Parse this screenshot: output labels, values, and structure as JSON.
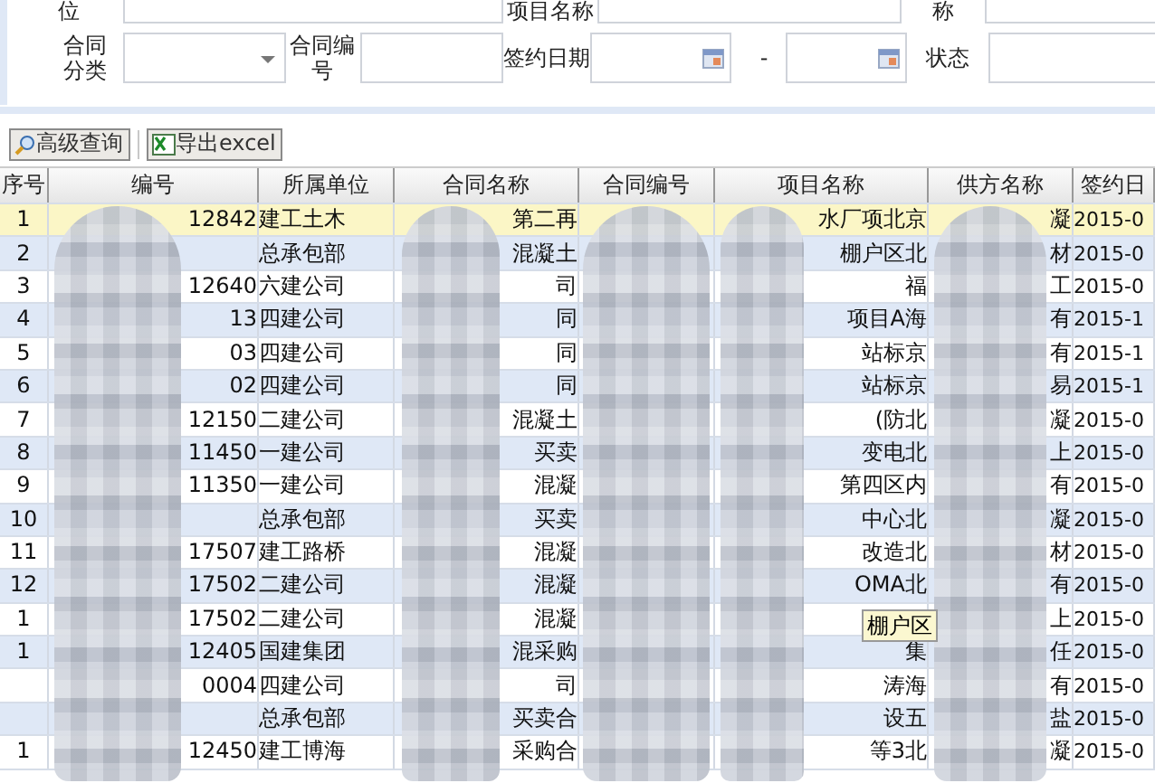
{
  "filter_form": {
    "row_1": [
      {
        "label": "位"
      },
      {
        "label": "项目名称"
      },
      {
        "label": "称"
      }
    ],
    "row_2": {
      "category": {
        "label": "合同分类"
      },
      "contract_no": {
        "label": "合同编号"
      },
      "sign_date": {
        "label": "签约日期",
        "separator": "-"
      },
      "status": {
        "label": "状态"
      }
    }
  },
  "toolbar": {
    "buttons": [
      {
        "label": "高级查询",
        "kind": "search"
      },
      {
        "label": "导出excel",
        "kind": "excel"
      }
    ]
  },
  "table": {
    "columns": [
      "序号",
      "编号",
      "所属单位",
      "合同名称",
      "合同编号",
      "项目名称",
      "供方名称",
      "签约日"
    ],
    "rows": [
      {
        "selected": true,
        "no": "1",
        "code": "12842",
        "unit": "建工土木",
        "name": "第二再",
        "project": "水厂项北京",
        "supplier": "凝",
        "date": "2015-0"
      },
      {
        "selected": false,
        "no": "2",
        "unit": "总承包部",
        "name": "混凝土",
        "project": "棚户区北",
        "supplier": "材",
        "date": "2015-0"
      },
      {
        "selected": false,
        "no": "3",
        "code": "12640",
        "unit": "六建公司",
        "name": "司",
        "project": "福",
        "supplier": "工",
        "date": "2015-0"
      },
      {
        "selected": false,
        "no": "4",
        "code": "13",
        "unit": "四建公司",
        "name": "同",
        "project": "项目A海",
        "supplier": "有",
        "date": "2015-1"
      },
      {
        "selected": false,
        "no": "5",
        "code": "03",
        "unit": "四建公司",
        "name": "同",
        "project": "站标京",
        "supplier": "有",
        "date": "2015-1"
      },
      {
        "selected": false,
        "no": "6",
        "code": "02",
        "unit": "四建公司",
        "name": "同",
        "project": "站标京",
        "supplier": "易",
        "date": "2015-1"
      },
      {
        "selected": false,
        "no": "7",
        "code": "12150",
        "unit": "二建公司",
        "name": "混凝土",
        "project": "(防北",
        "supplier": "凝",
        "date": "2015-0"
      },
      {
        "selected": false,
        "no": "8",
        "code": "11450",
        "unit": "一建公司",
        "name": "买卖",
        "project": "变电北",
        "supplier": "上",
        "date": "2015-0"
      },
      {
        "selected": false,
        "no": "9",
        "code": "11350",
        "unit": "一建公司",
        "name": "混凝",
        "project": "第四区内",
        "supplier": "有",
        "date": "2015-0"
      },
      {
        "selected": false,
        "no": "10",
        "unit": "总承包部",
        "name": "买卖",
        "project": "中心北",
        "supplier": "凝",
        "date": "2015-0"
      },
      {
        "selected": false,
        "no": "11",
        "code": "17507",
        "unit": "建工路桥",
        "name": "混凝",
        "project": "改造北",
        "supplier": "材",
        "date": "2015-0"
      },
      {
        "selected": false,
        "no": "12",
        "code": "17502",
        "unit": "二建公司",
        "name": "混凝",
        "project": "OMA北",
        "supplier": "有",
        "date": "2015-0"
      },
      {
        "selected": false,
        "no": "1",
        "code": "17502",
        "unit": "二建公司",
        "name": "混凝",
        "supplier": "上",
        "date": "2015-0"
      },
      {
        "selected": false,
        "no": "1",
        "code": "12405",
        "unit": "国建集团",
        "name": "混采购",
        "project": "集",
        "supplier": "任",
        "date": "2015-0"
      },
      {
        "selected": false,
        "code": "0004",
        "unit": "四建公司",
        "name": "司",
        "project": "涛海",
        "supplier": "有",
        "date": "2015-0"
      },
      {
        "selected": false,
        "unit": "总承包部",
        "name": "买卖合",
        "project": "设五",
        "supplier": "盐",
        "date": "2015-0"
      },
      {
        "selected": false,
        "no": "1",
        "code": "12450",
        "unit": "建工博海",
        "name": "采购合",
        "project": "等3北",
        "supplier": "凝",
        "date": "2015-0"
      }
    ]
  },
  "tooltip": {
    "text": "棚户区"
  }
}
